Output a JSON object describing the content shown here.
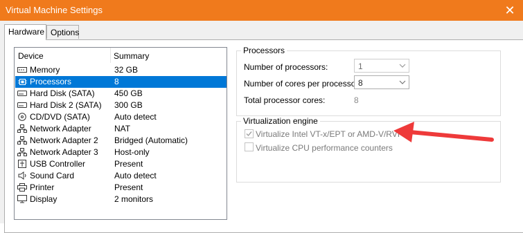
{
  "window": {
    "title": "Virtual Machine Settings",
    "close_glyph": "✕"
  },
  "tabs": [
    {
      "label": "Hardware",
      "active": true
    },
    {
      "label": "Options",
      "active": false
    }
  ],
  "device_list": {
    "col_device": "Device",
    "col_summary": "Summary",
    "selected_index": 1,
    "items": [
      {
        "icon": "memory-icon",
        "name": "Memory",
        "summary": "32 GB"
      },
      {
        "icon": "processor-icon",
        "name": "Processors",
        "summary": "8"
      },
      {
        "icon": "hard-disk-icon",
        "name": "Hard Disk (SATA)",
        "summary": "450 GB"
      },
      {
        "icon": "hard-disk-icon",
        "name": "Hard Disk 2 (SATA)",
        "summary": "300 GB"
      },
      {
        "icon": "cd-dvd-icon",
        "name": "CD/DVD (SATA)",
        "summary": "Auto detect"
      },
      {
        "icon": "network-adapter-icon",
        "name": "Network Adapter",
        "summary": "NAT"
      },
      {
        "icon": "network-adapter-icon",
        "name": "Network Adapter 2",
        "summary": "Bridged (Automatic)"
      },
      {
        "icon": "network-adapter-icon",
        "name": "Network Adapter 3",
        "summary": "Host-only"
      },
      {
        "icon": "usb-icon",
        "name": "USB Controller",
        "summary": "Present"
      },
      {
        "icon": "sound-card-icon",
        "name": "Sound Card",
        "summary": "Auto detect"
      },
      {
        "icon": "printer-icon",
        "name": "Printer",
        "summary": "Present"
      },
      {
        "icon": "display-icon",
        "name": "Display",
        "summary": "2 monitors"
      }
    ]
  },
  "processors": {
    "legend": "Processors",
    "num_processors_label": "Number of processors:",
    "num_processors_value": "1",
    "cores_label": "Number of cores per processor:",
    "cores_value": "8",
    "total_label": "Total processor cores:",
    "total_value": "8"
  },
  "virtualization": {
    "legend": "Virtualization engine",
    "opt1_label": "Virtualize Intel VT-x/EPT or AMD-V/RVI",
    "opt1_checked": true,
    "opt2_label": "Virtualize CPU performance counters",
    "opt2_checked": false
  },
  "colors": {
    "titlebar": "#f07a1c",
    "selection": "#0078d7",
    "annotation_arrow": "#ee3a3a"
  }
}
